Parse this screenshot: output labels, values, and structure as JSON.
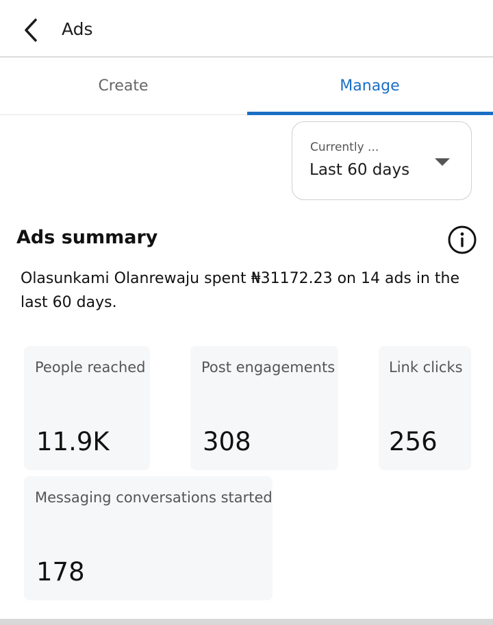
{
  "header": {
    "title": "Ads",
    "back_icon": "chevron-left-icon"
  },
  "tabs": [
    {
      "label": "Create",
      "active": false
    },
    {
      "label": "Manage",
      "active": true
    }
  ],
  "date_filter": {
    "caption": "Currently ...",
    "value": "Last 60 days",
    "icon": "caret-down-icon"
  },
  "summary": {
    "title": "Ads summary",
    "info_icon": "info-icon",
    "text": "Olasunkami Olanrewaju spent ₦31172.23 on 14 ads in the last 60 days."
  },
  "metrics": [
    {
      "label": "People reached",
      "value": "11.9K"
    },
    {
      "label": "Post engagements",
      "value": "308"
    },
    {
      "label": "Link clicks",
      "value": "256"
    },
    {
      "label": "Messaging conversations started",
      "value": "178"
    }
  ],
  "colors": {
    "accent": "#1a6fc4",
    "card_background": "#f6f7f9",
    "muted_text": "#555555"
  }
}
